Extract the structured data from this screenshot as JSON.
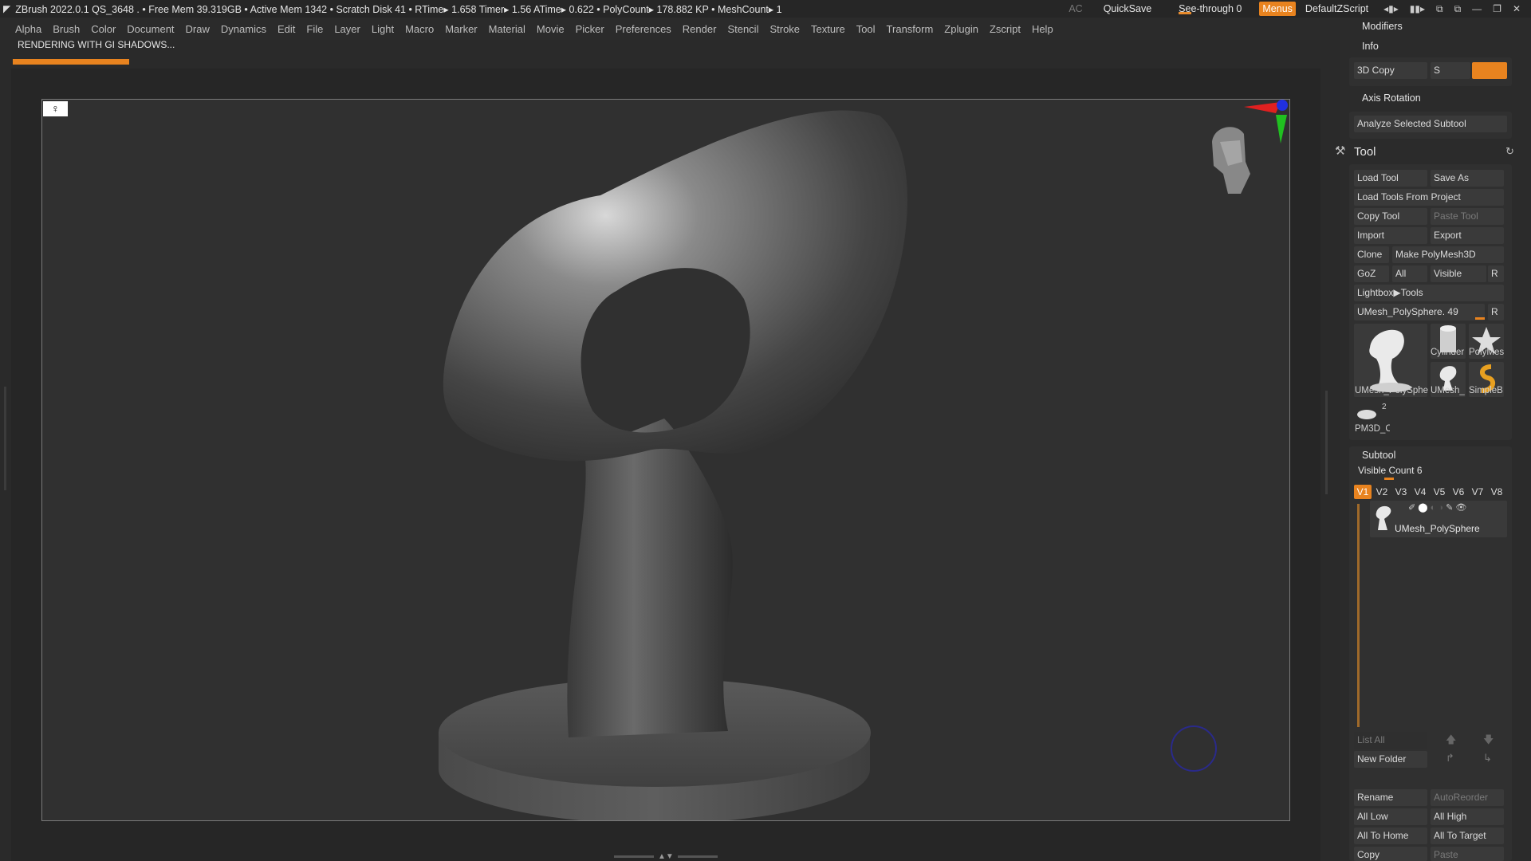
{
  "titlebar": {
    "text": "ZBrush 2022.0.1   QS_3648   . • Free Mem 39.319GB • Active Mem 1342 • Scratch Disk 41 •  RTime▸ 1.658 Timer▸ 1.56 ATime▸ 0.622 • PolyCount▸ 178.882 KP  • MeshCount▸ 1",
    "ac": "AC",
    "quicksave": "QuickSave",
    "seethrough": "See-through  0",
    "menus": "Menus",
    "defaultzscript": "DefaultZScript"
  },
  "menubar": [
    "Alpha",
    "Brush",
    "Color",
    "Document",
    "Draw",
    "Dynamics",
    "Edit",
    "File",
    "Layer",
    "Light",
    "Macro",
    "Marker",
    "Material",
    "Movie",
    "Picker",
    "Preferences",
    "Render",
    "Stencil",
    "Stroke",
    "Texture",
    "Tool",
    "Transform",
    "Zplugin",
    "Zscript",
    "Help"
  ],
  "status": "RENDERING WITH GI SHADOWS...",
  "render_progress_pct": 15,
  "panel": {
    "modifiers": "Modifiers",
    "info": "Info",
    "copy3d": "3D Copy",
    "s_label": "S",
    "axis_rotation": "Axis Rotation",
    "analyze": "Analyze Selected Subtool",
    "tool_title": "Tool",
    "load_tool": "Load Tool",
    "save_as": "Save As",
    "load_from_project": "Load Tools From Project",
    "copy_tool": "Copy Tool",
    "paste_tool": "Paste Tool",
    "import": "Import",
    "export": "Export",
    "clone": "Clone",
    "make_polymesh": "Make PolyMesh3D",
    "goz": "GoZ",
    "all": "All",
    "visible": "Visible",
    "r": "R",
    "lightbox_tools": "Lightbox▶Tools",
    "current_tool": "UMesh_PolySphere. 49",
    "thumb_main": "UMesh_PolySphe",
    "thumb_cyl": "Cylinder",
    "thumb_poly": "PolyMes",
    "thumb_umesh": "UMesh_",
    "thumb_simple": "SimpleB",
    "thumb_pm3d": "PM3D_C",
    "pm3d_count": "2",
    "subtool_title": "Subtool",
    "visible_count": "Visible Count 6",
    "vtabs": [
      "V1",
      "V2",
      "V3",
      "V4",
      "V5",
      "V6",
      "V7",
      "V8"
    ],
    "subtool_name": "UMesh_PolySphere",
    "list_all": "List All",
    "new_folder": "New Folder",
    "rename": "Rename",
    "auto_reorder": "AutoReorder",
    "all_low": "All Low",
    "all_high": "All High",
    "all_to_home": "All To Home",
    "all_to_target": "All To Target",
    "copy": "Copy",
    "paste": "Paste"
  },
  "viewport": {
    "persp_icon": "person-icon",
    "nav_head": "head-navigator-icon"
  }
}
